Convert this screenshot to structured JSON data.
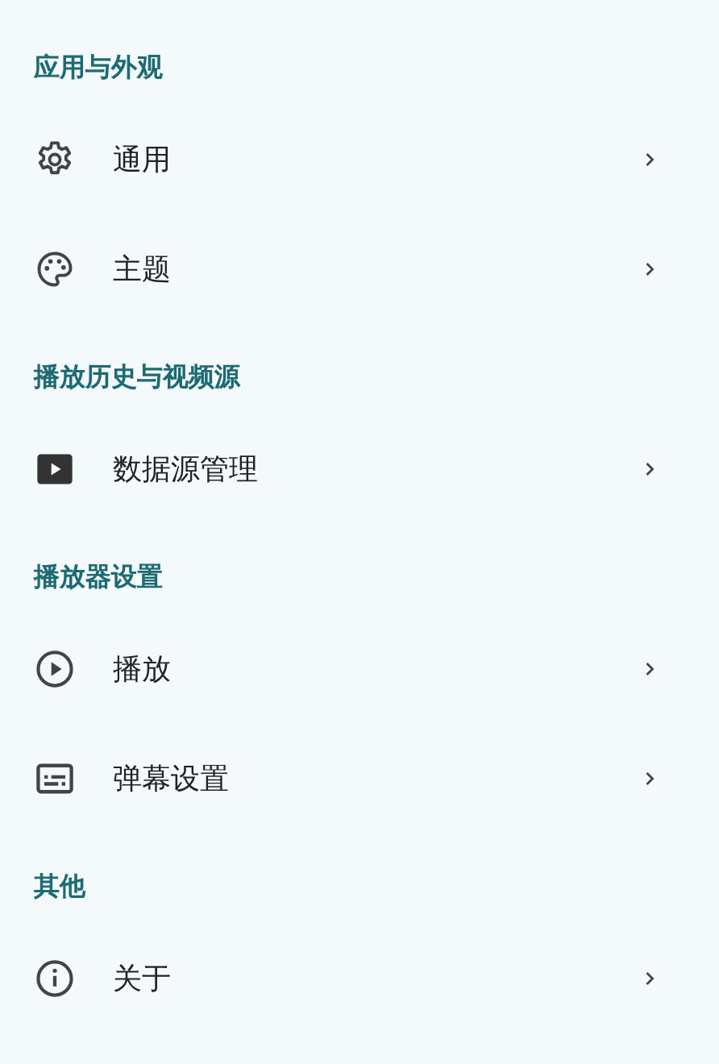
{
  "sections": [
    {
      "title": "应用与外观",
      "items": [
        {
          "label": "通用",
          "kind": "gear"
        },
        {
          "label": "主题",
          "kind": "palette"
        }
      ]
    },
    {
      "title": "播放历史与视频源",
      "items": [
        {
          "label": "数据源管理",
          "kind": "video"
        }
      ]
    },
    {
      "title": "播放器设置",
      "items": [
        {
          "label": "播放",
          "kind": "play"
        },
        {
          "label": "弹幕设置",
          "kind": "subtitles"
        }
      ]
    },
    {
      "title": "其他",
      "items": [
        {
          "label": "关于",
          "kind": "info"
        }
      ]
    }
  ]
}
